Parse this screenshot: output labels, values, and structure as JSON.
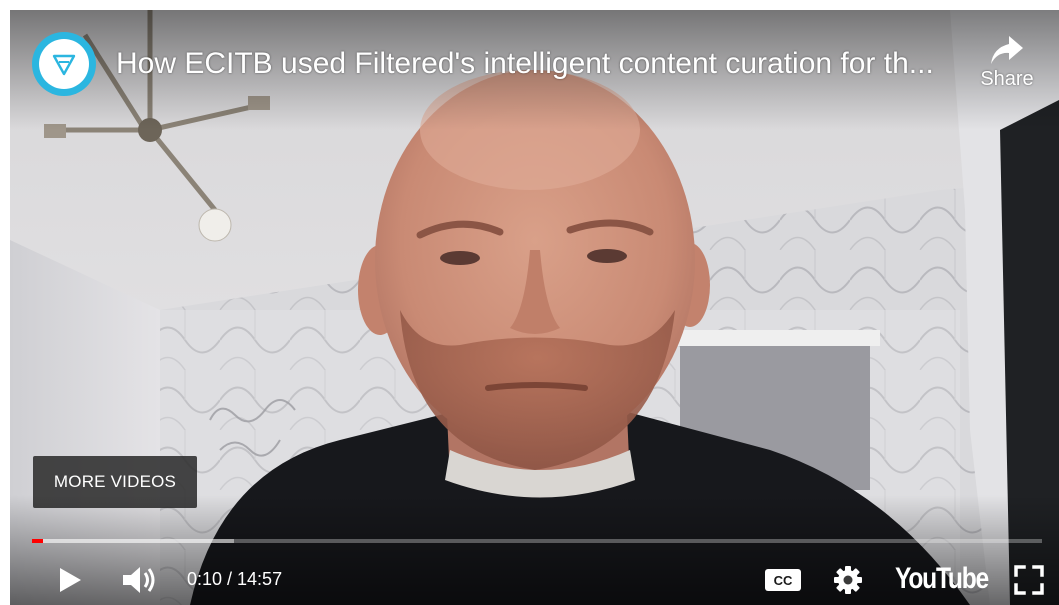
{
  "video": {
    "title": "How ECITB used Filtered's intelligent content curation for th...",
    "channel_logo_icon": "filtered-triangle-logo-icon"
  },
  "share": {
    "label": "Share",
    "icon": "share-arrow-icon"
  },
  "more_videos": {
    "label": "MORE VIDEOS"
  },
  "progress": {
    "current_seconds": 10,
    "duration_seconds": 897,
    "played_fraction": 0.011,
    "buffered_fraction": 0.2
  },
  "controls": {
    "play_icon": "play-icon",
    "volume_icon": "volume-icon",
    "time_text": "0:10 / 14:57",
    "cc_icon": "cc-icon",
    "cc_label": "CC",
    "settings_icon": "gear-icon",
    "youtube_label": "YouTube",
    "fullscreen_icon": "fullscreen-icon"
  },
  "colors": {
    "progress_played": "#ff0000",
    "channel_accent": "#2bb6e0",
    "control_text": "#ffffff"
  }
}
